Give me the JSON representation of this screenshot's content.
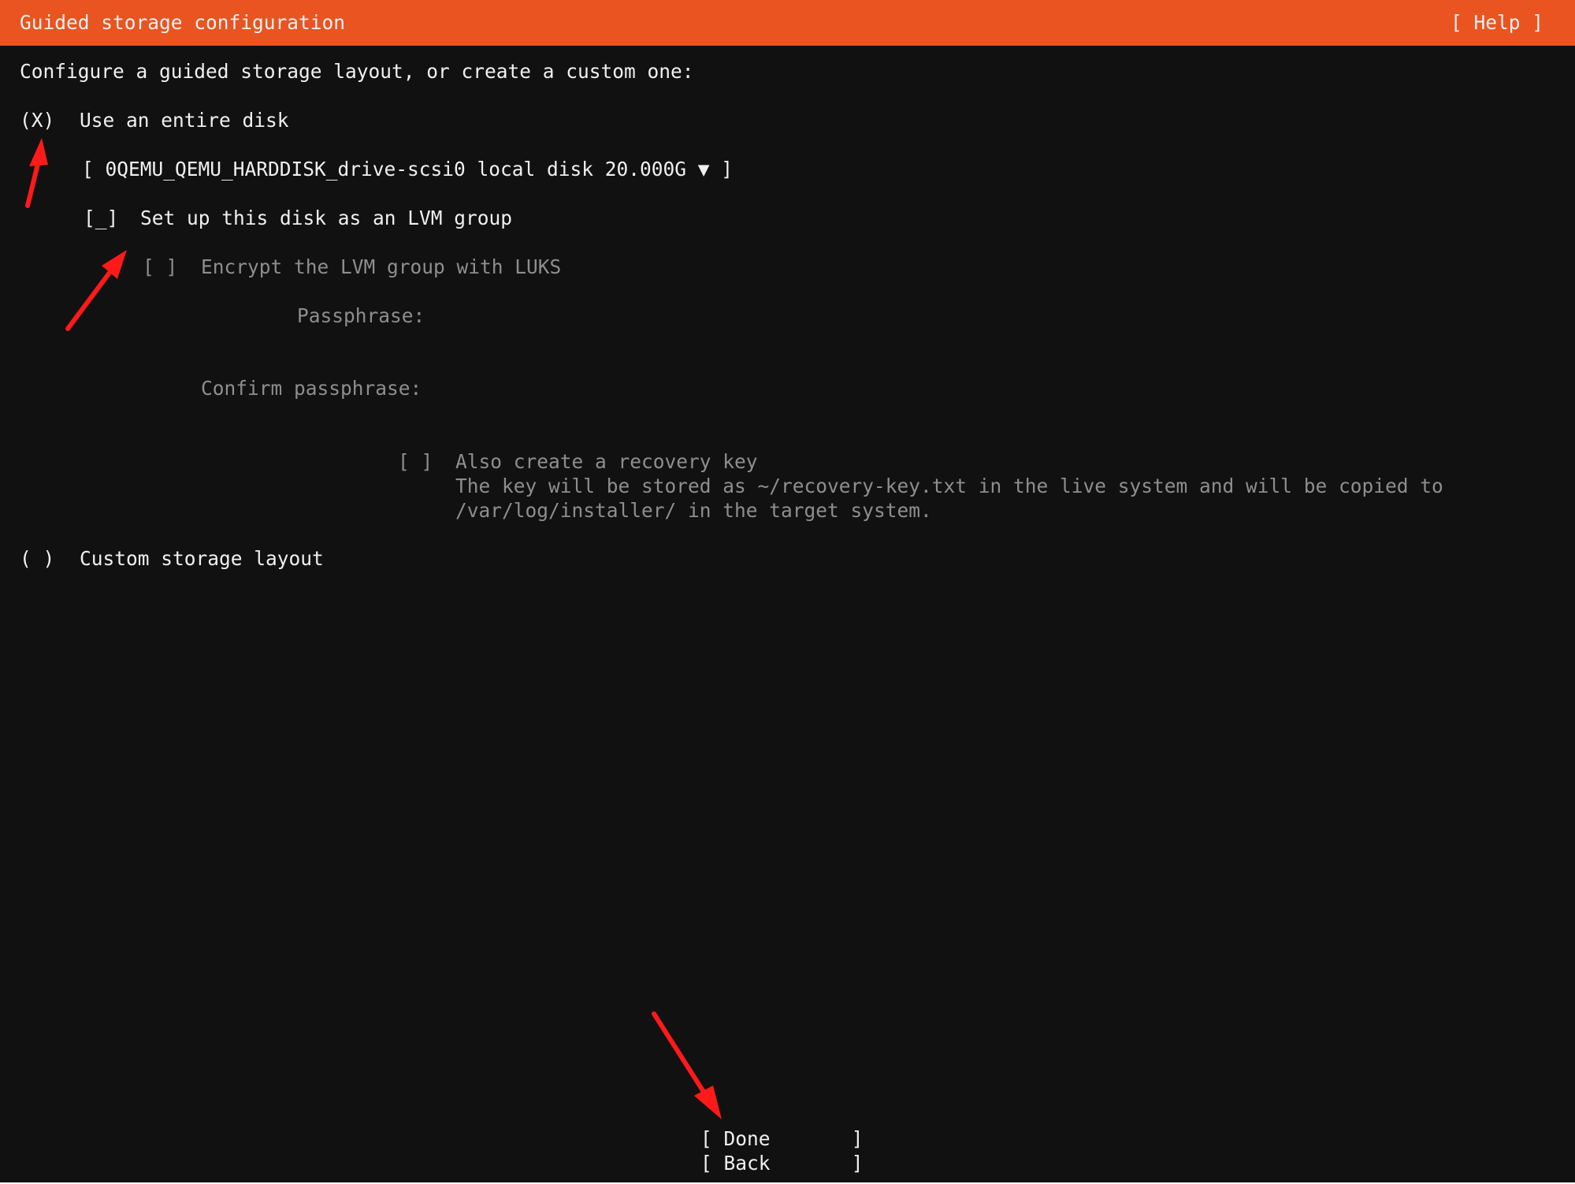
{
  "header": {
    "title": "Guided storage configuration",
    "help": "[ Help ]"
  },
  "intro": "Configure a guided storage layout, or create a custom one:",
  "entire_disk": {
    "radio": "(X)",
    "label": "Use an entire disk",
    "disk_select": "[ 0QEMU_QEMU_HARDDISK_drive-scsi0 local disk 20.000G ▼ ]",
    "lvm_checkbox": "[_]",
    "lvm_label": "Set up this disk as an LVM group",
    "encrypt_checkbox": "[ ]",
    "encrypt_label": "Encrypt the LVM group with LUKS",
    "passphrase_label": "Passphrase:",
    "confirm_label": "Confirm passphrase:",
    "recovery_checkbox": "[ ]",
    "recovery_label": "Also create a recovery key",
    "recovery_help_1": "The key will be stored as ~/recovery-key.txt in the live system and will be copied to",
    "recovery_help_2": "/var/log/installer/ in the target system."
  },
  "custom": {
    "radio": "( )",
    "label": "Custom storage layout"
  },
  "buttons": {
    "done": "[ Done       ]",
    "back": "[ Back       ]"
  },
  "colors": {
    "header_bg": "#e95420",
    "background": "#111111",
    "text": "#f0f0f0",
    "disabled_text": "#8e8e8e",
    "annotation_arrow": "#ff1a1a"
  }
}
